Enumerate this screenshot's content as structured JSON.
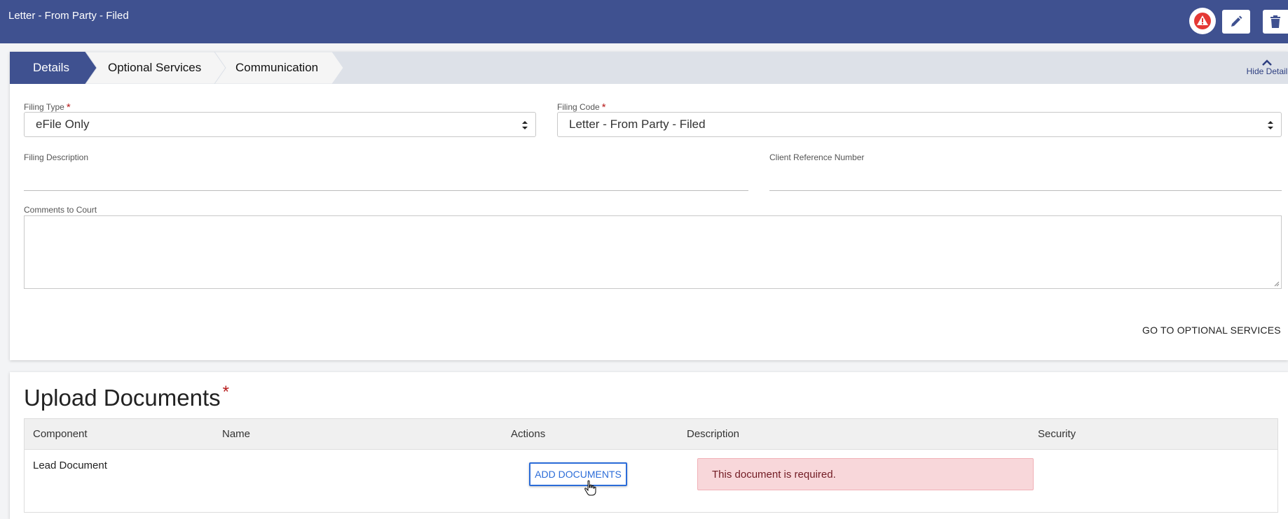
{
  "header": {
    "title": "Letter - From Party - Filed",
    "alert_icon": "alert-triangle-icon",
    "edit_icon": "pencil-icon",
    "delete_icon": "trash-icon"
  },
  "tabs": [
    {
      "label": "Details",
      "active": true
    },
    {
      "label": "Optional Services",
      "active": false
    },
    {
      "label": "Communication",
      "active": false
    }
  ],
  "hide_detail": "Hide Detail",
  "form": {
    "filing_type_label": "Filing Type",
    "filing_type_value": "eFile Only",
    "filing_code_label": "Filing Code",
    "filing_code_value": "Letter - From Party - Filed",
    "filing_description_label": "Filing Description",
    "filing_description_value": "",
    "client_reference_label": "Client Reference Number",
    "client_reference_value": "",
    "comments_label": "Comments to Court",
    "comments_value": "",
    "go_optional": "GO TO OPTIONAL SERVICES",
    "required_mark": "*"
  },
  "upload": {
    "title": "Upload Documents",
    "columns": [
      "Component",
      "Name",
      "Actions",
      "Description",
      "Security"
    ],
    "rows": [
      {
        "component": "Lead Document",
        "action_label": "ADD DOCUMENTS",
        "description_error": "This document is required."
      }
    ]
  },
  "colors": {
    "header_bg": "#3f5190",
    "active_tab": "#3f5190",
    "error_bg": "#f8d7da",
    "button_blue": "#2b6cd8"
  }
}
